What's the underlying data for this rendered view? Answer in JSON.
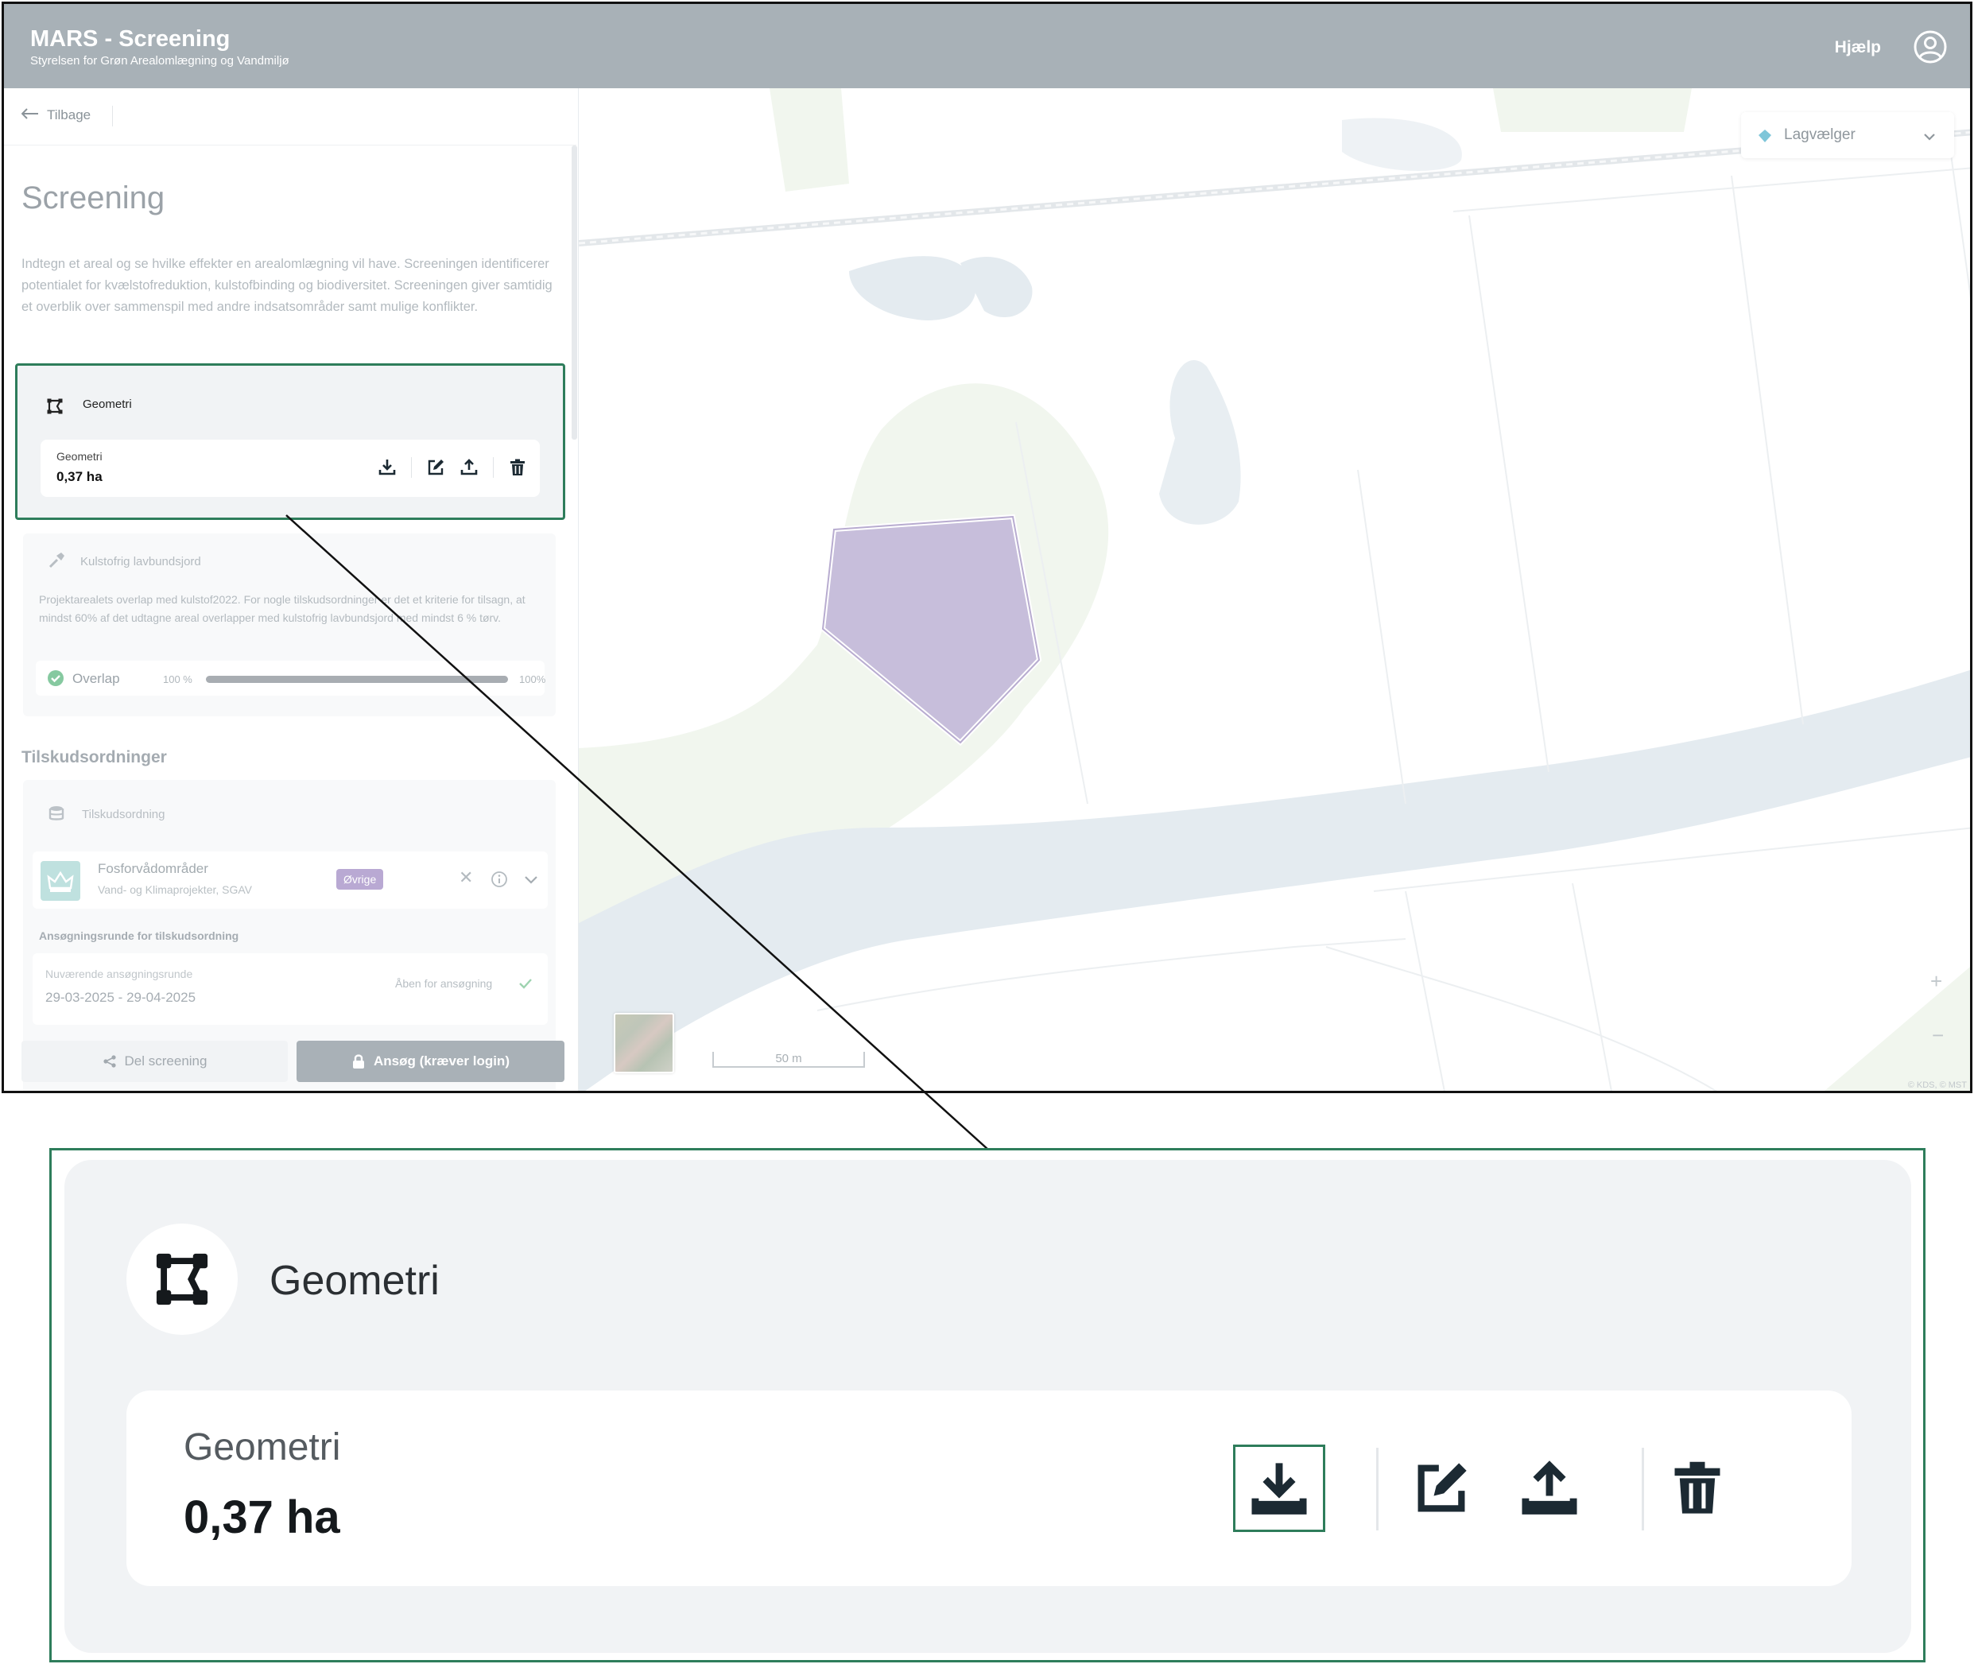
{
  "header": {
    "title": "MARS - Screening",
    "subtitle": "Styrelsen for Grøn Arealomlægning og Vandmiljø",
    "help_label": "Hjælp"
  },
  "sidebar": {
    "back_label": "Tilbage",
    "page_title": "Screening",
    "intro": "Indtegn et areal og se hvilke effekter en arealomlægning vil have. Screeningen identificerer potentialet for kvælstofreduktion, kulstofbinding og biodiversitet. Screeningen giver samtidig et overblik over sammenspil med andre indsatsområder samt mulige konflikter.",
    "geometry_card": {
      "heading": "Geometri",
      "item_label": "Geometri",
      "item_value": "0,37 ha"
    },
    "kulstof_card": {
      "heading": "Kulstofrig lavbundsjord",
      "description": "Projektarealets overlap med kulstof2022. For nogle tilskudsordninger er det et kriterie for tilsagn, at mindst 60% af det udtagne areal overlapper med kulstofrig lavbundsjord med mindst 6 % tørv.",
      "overlap_label": "Overlap",
      "overlap_value": "100 %",
      "overlap_max": "100%",
      "overlap_fraction": 1.0
    },
    "tilskud_heading": "Tilskudsordninger",
    "tilskud_card": {
      "heading": "Tilskudsordning",
      "scheme_name": "Fosforvådområder",
      "scheme_sub": "Vand- og Klimaprojekter, SGAV",
      "scheme_badge": "Øvrige",
      "round_heading": "Ansøgningsrunde for tilskudsordning",
      "round_label": "Nuværende ansøgningsrunde",
      "round_dates": "29-03-2025 - 29-04-2025",
      "round_status": "Åben for ansøgning"
    },
    "share_label": "Del screening",
    "apply_label": "Ansøg (kræver login)"
  },
  "map": {
    "layer_picker_label": "Lagvælger",
    "zoom_in": "+",
    "zoom_out": "−",
    "scale_label": "50 m",
    "attribution": "© KDS, © MST",
    "polygon_color": "#c7bedb"
  },
  "zoom_inset": {
    "heading": "Geometri",
    "item_label": "Geometri",
    "item_value": "0,37 ha"
  },
  "colors": {
    "highlight": "#2e7d5b",
    "topbar": "#a8b1b7",
    "water": "#e4ebf0",
    "vegetation": "#f0f6ec"
  },
  "icons": {
    "user": "user-circle-icon",
    "geometry": "polygon-geometry-icon",
    "download": "download-icon",
    "edit": "edit-icon",
    "upload": "upload-icon",
    "delete": "trash-icon",
    "shovel": "shovel-icon",
    "coins": "coins-icon",
    "layers": "layers-icon"
  }
}
